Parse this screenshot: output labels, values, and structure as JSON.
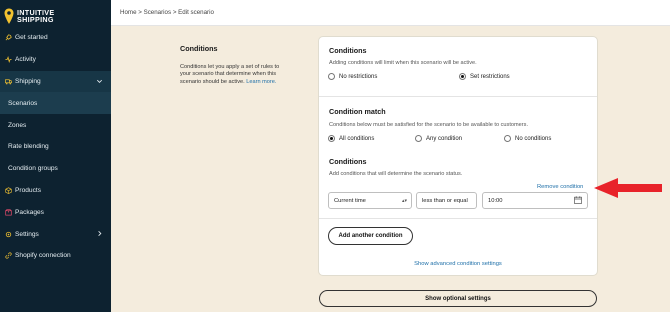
{
  "app": {
    "logo_line1": "INTUITIVE",
    "logo_line2": "SHIPPING",
    "brand_color": "#f2c230"
  },
  "sidebar": {
    "items": [
      {
        "label": "Get started",
        "icon": "rocket-icon"
      },
      {
        "label": "Activity",
        "icon": "activity-icon"
      },
      {
        "label": "Shipping",
        "icon": "truck-icon"
      },
      {
        "label": "Scenarios"
      },
      {
        "label": "Zones"
      },
      {
        "label": "Rate blending"
      },
      {
        "label": "Condition groups"
      },
      {
        "label": "Products",
        "icon": "box-icon"
      },
      {
        "label": "Packages",
        "icon": "package-icon"
      },
      {
        "label": "Settings",
        "icon": "gear-icon"
      },
      {
        "label": "Shopify connection",
        "icon": "link-icon"
      }
    ]
  },
  "breadcrumb": {
    "home": "Home",
    "sep1": " > ",
    "scenarios": "Scenarios",
    "sep2": " > ",
    "current": "Edit scenario"
  },
  "description": {
    "title": "Conditions",
    "body": "Conditions let you apply a set of rules to your scenario that determine when this scenario should be active.",
    "link": "Learn more."
  },
  "conditions": {
    "title": "Conditions",
    "subtitle": "Adding conditions will limit when this scenario will be active.",
    "option_none": "No restrictions",
    "option_set": "Set restrictions",
    "selected": "Set restrictions"
  },
  "condition_match": {
    "title": "Condition match",
    "subtitle": "Conditions below must be satisfied for the scenario to be available to customers.",
    "options": [
      "All conditions",
      "Any condition",
      "No conditions"
    ],
    "selected": "All conditions"
  },
  "condition_list": {
    "title": "Conditions",
    "subtitle": "Add conditions that will determine the scenario status.",
    "remove_label": "Remove condition",
    "field_value": "Current time",
    "operator_value": "less than or equal",
    "time_value": "10:00"
  },
  "buttons": {
    "add_condition": "Add another condition",
    "advanced_settings": "Show advanced condition settings",
    "optional_settings": "Show optional settings"
  },
  "colors": {
    "sidebar_bg": "#0d2230",
    "page_bg": "#f4ecdd",
    "link": "#1e6fa8",
    "arrow": "#e8232a"
  }
}
